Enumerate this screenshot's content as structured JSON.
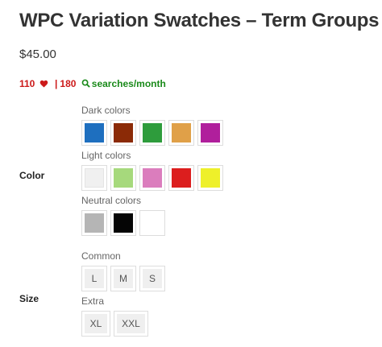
{
  "product": {
    "title": "WPC Variation Swatches – Term Groups",
    "price": "$45.00"
  },
  "stats": {
    "likes": "110",
    "searches": "180",
    "searches_label": "searches/month",
    "colors": {
      "likes": "#cc1a1a",
      "searches_label": "#1a8a1a"
    }
  },
  "attributes": {
    "color": {
      "label": "Color",
      "groups": [
        {
          "label": "Dark colors",
          "swatches": [
            "#1e6fbf",
            "#8b2a06",
            "#2e9c3c",
            "#e0a048",
            "#b01f9c"
          ]
        },
        {
          "label": "Light colors",
          "swatches": [
            "#f0f0f0",
            "#a6d97c",
            "#db7dbd",
            "#dc1e1e",
            "#eef02a"
          ]
        },
        {
          "label": "Neutral colors",
          "swatches": [
            "#b5b5b5",
            "#050505",
            "#ffffff"
          ]
        }
      ]
    },
    "size": {
      "label": "Size",
      "groups": [
        {
          "label": "Common",
          "options": [
            "L",
            "M",
            "S"
          ]
        },
        {
          "label": "Extra",
          "options": [
            "XL",
            "XXL"
          ]
        }
      ]
    }
  }
}
